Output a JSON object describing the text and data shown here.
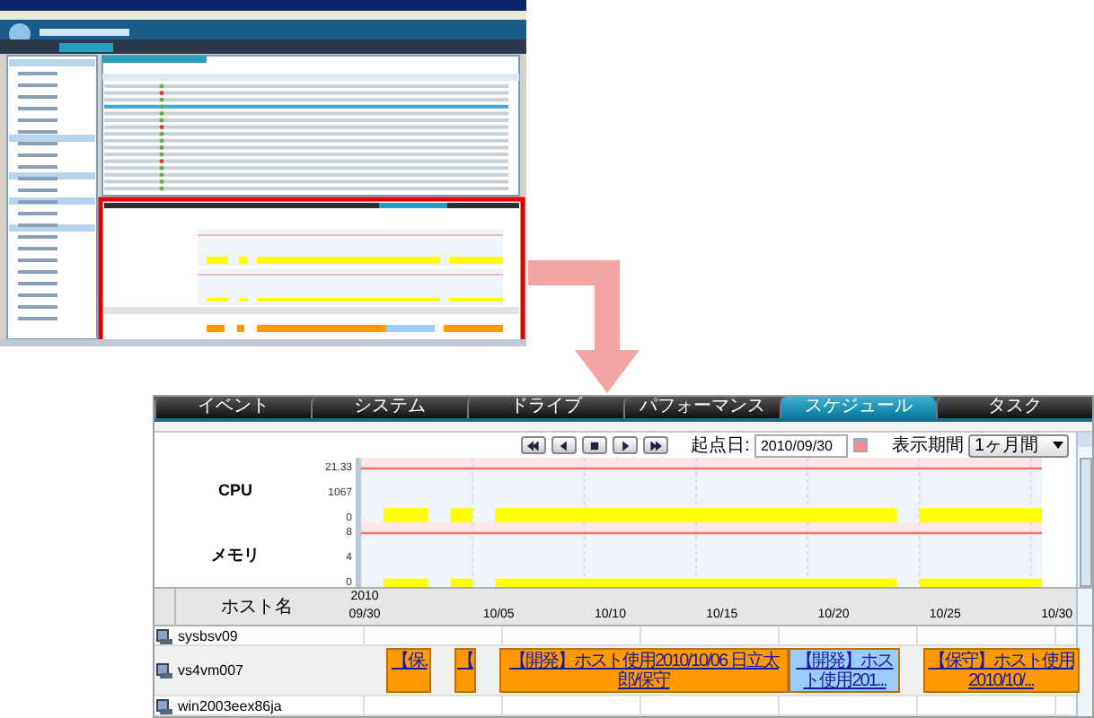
{
  "tabs": [
    {
      "label": "イベント",
      "selected": false
    },
    {
      "label": "システム",
      "selected": false
    },
    {
      "label": "ドライブ",
      "selected": false
    },
    {
      "label": "パフォーマンス",
      "selected": false
    },
    {
      "label": "スケジュール",
      "selected": true
    },
    {
      "label": "タスク",
      "selected": false
    }
  ],
  "toolbar": {
    "start_date_label": "起点日:",
    "start_date": "2010/09/30",
    "period_label": "表示期間",
    "period": "1ヶ月間"
  },
  "charts": [
    {
      "label": "CPU",
      "yticks": [
        "21.33",
        "1067",
        "0"
      ]
    },
    {
      "label": "メモリ",
      "yticks": [
        "8",
        "4",
        "0"
      ]
    }
  ],
  "schedule": {
    "column_label": "ホスト名",
    "year": "2010",
    "dates": [
      "09/30",
      "10/05",
      "10/10",
      "10/15",
      "10/20",
      "10/25",
      "10/30"
    ],
    "hosts": [
      {
        "name": "sysbsv09"
      },
      {
        "name": "vs4vm007",
        "bookings": [
          {
            "label": "【保.",
            "color": "#ff9900"
          },
          {
            "label": "【",
            "color": "#ff9900"
          },
          {
            "label": "【開発】ホスト使用2010/10/06 日立太郎/保守",
            "color": "#ff9900"
          },
          {
            "label": "【開発】ホスト使用201...",
            "color": "#99ccff"
          },
          {
            "label": "【保守】ホスト使用2010/10/...",
            "color": "#ff9900"
          }
        ]
      },
      {
        "name": "win2003eex86ja"
      }
    ]
  }
}
